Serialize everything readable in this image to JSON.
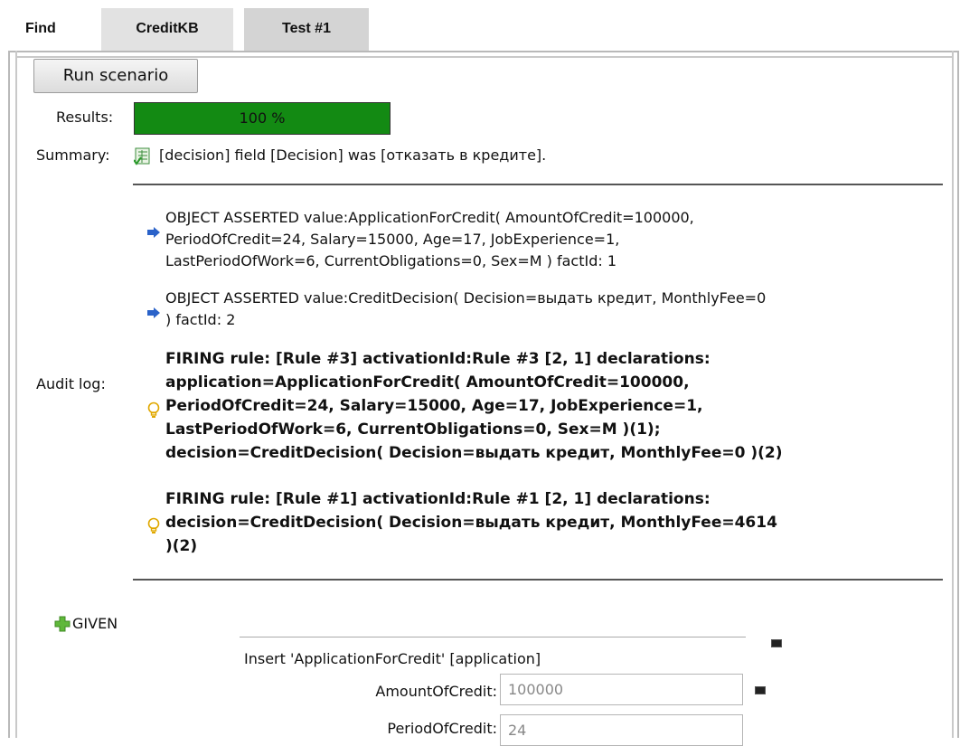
{
  "tabs": [
    {
      "label": "Find"
    },
    {
      "label": "CreditKB"
    },
    {
      "label": "Test #1"
    }
  ],
  "toolbar": {
    "run_label": "Run scenario"
  },
  "results": {
    "label": "Results:",
    "progress_text": "100 %",
    "progress_fraction": 1.0,
    "color": "#138a13"
  },
  "summary": {
    "label": "Summary:",
    "text": "[decision] field [Decision] was [отказать в кредите].",
    "icon": "spreadsheet-check-icon"
  },
  "audit": {
    "label": "Audit log:",
    "entries": [
      {
        "icon": "arrow-right-icon",
        "lines": [
          "OBJECT ASSERTED value:ApplicationForCredit( AmountOfCredit=100000,",
          "PeriodOfCredit=24, Salary=15000, Age=17, JobExperience=1,",
          "LastPeriodOfWork=6, CurrentObligations=0, Sex=M ) factId: 1"
        ]
      },
      {
        "icon": "arrow-right-icon",
        "lines": [
          "OBJECT ASSERTED value:CreditDecision( Decision=выдать кредит, MonthlyFee=0",
          ") factId: 2"
        ]
      },
      {
        "icon": "lightbulb-icon",
        "lines": [
          "FIRING rule: [Rule #3] activationId:Rule #3 [2, 1] declarations:",
          "application=ApplicationForCredit( AmountOfCredit=100000,",
          "PeriodOfCredit=24, Salary=15000, Age=17, JobExperience=1,",
          "LastPeriodOfWork=6, CurrentObligations=0, Sex=M )(1);",
          "decision=CreditDecision( Decision=выдать кредит, MonthlyFee=0 )(2)"
        ]
      },
      {
        "icon": "lightbulb-icon",
        "lines": [
          "FIRING rule: [Rule #1] activationId:Rule #1 [2, 1] declarations:",
          "decision=CreditDecision( Decision=выдать кредит, MonthlyFee=4614",
          ")(2)"
        ]
      }
    ]
  },
  "given": {
    "label": "GIVEN",
    "icon": "plus-icon"
  },
  "insert": {
    "text": "Insert 'ApplicationForCredit' [application]"
  },
  "fields": [
    {
      "label": "AmountOfCredit:",
      "value": "100000"
    },
    {
      "label": "PeriodOfCredit:",
      "value": "24"
    }
  ],
  "colors": {
    "progress": "#138a13",
    "arrow": "#2a62c9",
    "bulb": "#f0c020",
    "plus": "#4aa02c"
  }
}
